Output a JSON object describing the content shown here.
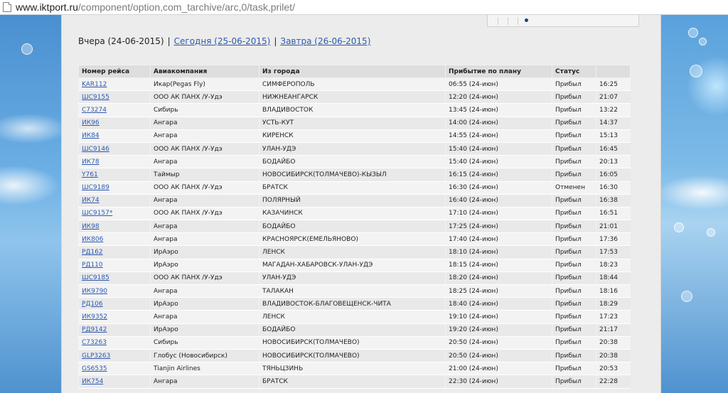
{
  "address_bar": {
    "host": "www.iktport.ru",
    "path": "/component/option,com_tarchive/arc,0/task,prilet/"
  },
  "day_nav": {
    "yesterday": "Вчера (24-06-2015)",
    "today": "Сегодня (25-06-2015)",
    "tomorrow": "Завтра (26-06-2015)",
    "separator": "|"
  },
  "table": {
    "headers": [
      "Номер рейса",
      "Авиакомпания",
      "Из города",
      "Прибытие по плану",
      "Статус",
      ""
    ],
    "rows": [
      {
        "flight": "KAR112",
        "airline": "Икар(Pegas Fly)",
        "from": "СИМФЕРОПОЛЬ",
        "planned": "06:55 (24-июн)",
        "status": "Прибыл",
        "actual": "16:25"
      },
      {
        "flight": "ШС9155",
        "airline": "ООО АК ПАНХ /У-Удэ",
        "from": "НИЖНЕАНГАРСК",
        "planned": "12:20 (24-июн)",
        "status": "Прибыл",
        "actual": "21:07"
      },
      {
        "flight": "С73274",
        "airline": "Сибирь",
        "from": "ВЛАДИВОСТОК",
        "planned": "13:45 (24-июн)",
        "status": "Прибыл",
        "actual": "13:22"
      },
      {
        "flight": "ИК96",
        "airline": "Ангара",
        "from": "УСТЬ-КУТ",
        "planned": "14:00 (24-июн)",
        "status": "Прибыл",
        "actual": "14:37"
      },
      {
        "flight": "ИК84",
        "airline": "Ангара",
        "from": "КИРЕНСК",
        "planned": "14:55 (24-июн)",
        "status": "Прибыл",
        "actual": "15:13"
      },
      {
        "flight": "ШС9146",
        "airline": "ООО АК ПАНХ /У-Удэ",
        "from": "УЛАН-УДЭ",
        "planned": "15:40 (24-июн)",
        "status": "Прибыл",
        "actual": "16:45"
      },
      {
        "flight": "ИК78",
        "airline": "Ангара",
        "from": "БОДАЙБО",
        "planned": "15:40 (24-июн)",
        "status": "Прибыл",
        "actual": "20:13"
      },
      {
        "flight": "Y761",
        "airline": "Таймыр",
        "from": "НОВОСИБИРСК(ТОЛМАЧЕВО)-КЫЗЫЛ",
        "planned": "16:15 (24-июн)",
        "status": "Прибыл",
        "actual": "16:05"
      },
      {
        "flight": "ШС9189",
        "airline": "ООО АК ПАНХ /У-Удэ",
        "from": "БРАТСК",
        "planned": "16:30 (24-июн)",
        "status": "Отменен",
        "actual": "16:30"
      },
      {
        "flight": "ИК74",
        "airline": "Ангара",
        "from": "ПОЛЯРНЫЙ",
        "planned": "16:40 (24-июн)",
        "status": "Прибыл",
        "actual": "16:38"
      },
      {
        "flight": "ШС9157*",
        "airline": "ООО АК ПАНХ /У-Удэ",
        "from": "КАЗАЧИНСК",
        "planned": "17:10 (24-июн)",
        "status": "Прибыл",
        "actual": "16:51"
      },
      {
        "flight": "ИК98",
        "airline": "Ангара",
        "from": "БОДАЙБО",
        "planned": "17:25 (24-июн)",
        "status": "Прибыл",
        "actual": "21:01"
      },
      {
        "flight": "ИК806",
        "airline": "Ангара",
        "from": "КРАСНОЯРСК(ЕМЕЛЬЯНОВО)",
        "planned": "17:40 (24-июн)",
        "status": "Прибыл",
        "actual": "17:36"
      },
      {
        "flight": "РД162",
        "airline": "ИрАэро",
        "from": "ЛЕНСК",
        "planned": "18:10 (24-июн)",
        "status": "Прибыл",
        "actual": "17:53"
      },
      {
        "flight": "РД110",
        "airline": "ИрАэро",
        "from": "МАГАДАН-ХАБАРОВСК-УЛАН-УДЭ",
        "planned": "18:15 (24-июн)",
        "status": "Прибыл",
        "actual": "18:23"
      },
      {
        "flight": "ШС9185",
        "airline": "ООО АК ПАНХ /У-Удэ",
        "from": "УЛАН-УДЭ",
        "planned": "18:20 (24-июн)",
        "status": "Прибыл",
        "actual": "18:44"
      },
      {
        "flight": "ИК9790",
        "airline": "Ангара",
        "from": "ТАЛАКАН",
        "planned": "18:25 (24-июн)",
        "status": "Прибыл",
        "actual": "18:16"
      },
      {
        "flight": "РД106",
        "airline": "ИрАэро",
        "from": "ВЛАДИВОСТОК-БЛАГОВЕЩЕНСК-ЧИТА",
        "planned": "18:40 (24-июн)",
        "status": "Прибыл",
        "actual": "18:29"
      },
      {
        "flight": "ИК9352",
        "airline": "Ангара",
        "from": "ЛЕНСК",
        "planned": "19:10 (24-июн)",
        "status": "Прибыл",
        "actual": "17:23"
      },
      {
        "flight": "РД9142",
        "airline": "ИрАэро",
        "from": "БОДАЙБО",
        "planned": "19:20 (24-июн)",
        "status": "Прибыл",
        "actual": "21:17"
      },
      {
        "flight": "С73263",
        "airline": "Сибирь",
        "from": "НОВОСИБИРСК(ТОЛМАЧЕВО)",
        "planned": "20:50 (24-июн)",
        "status": "Прибыл",
        "actual": "20:38"
      },
      {
        "flight": "GLP3263",
        "airline": "Глобус (Новосибирск)",
        "from": "НОВОСИБИРСК(ТОЛМАЧЕВО)",
        "planned": "20:50 (24-июн)",
        "status": "Прибыл",
        "actual": "20:38"
      },
      {
        "flight": "GS6535",
        "airline": "Tianjin Airlines",
        "from": "ТЯНЬЦЗИНЬ",
        "planned": "21:00 (24-июн)",
        "status": "Прибыл",
        "actual": "20:53"
      },
      {
        "flight": "ИК754",
        "airline": "Ангара",
        "from": "БРАТСК",
        "planned": "22:30 (24-июн)",
        "status": "Прибыл",
        "actual": "22:28"
      }
    ]
  }
}
